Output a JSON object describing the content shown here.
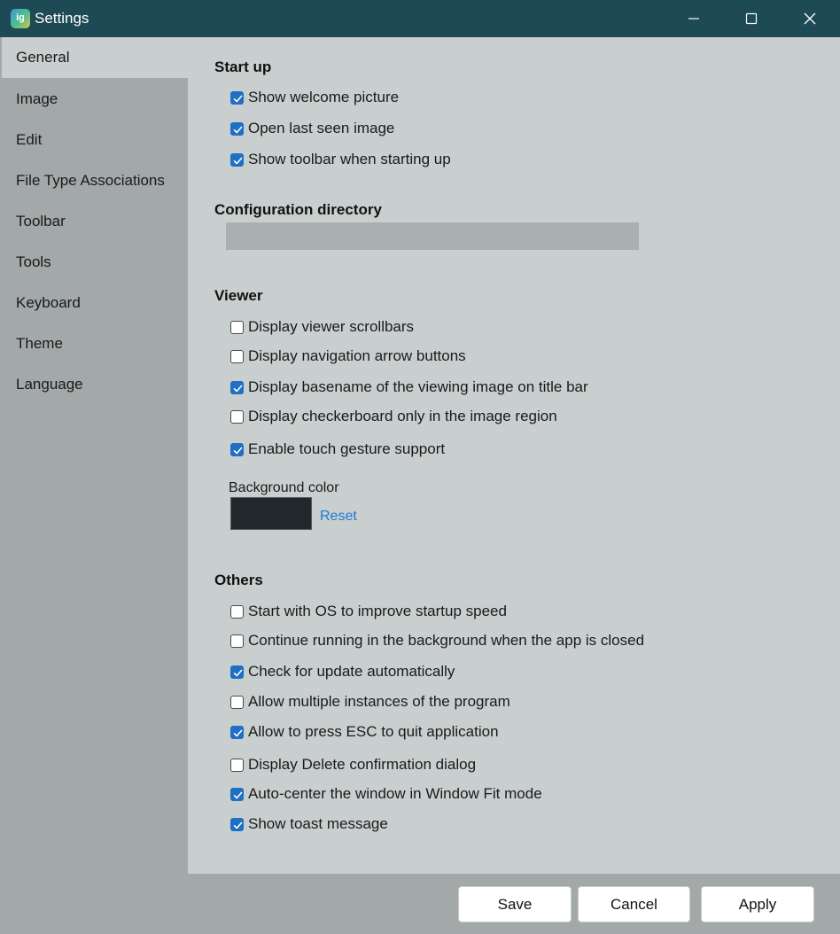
{
  "window": {
    "title": "Settings",
    "app_icon_text": "ig",
    "controls": [
      "minimize-icon",
      "maximize-icon",
      "close-icon"
    ]
  },
  "sidebar": {
    "items": [
      {
        "label": "General",
        "active": true
      },
      {
        "label": "Image",
        "active": false
      },
      {
        "label": "Edit",
        "active": false
      },
      {
        "label": "File Type Associations",
        "active": false
      },
      {
        "label": "Toolbar",
        "active": false
      },
      {
        "label": "Tools",
        "active": false
      },
      {
        "label": "Keyboard",
        "active": false
      },
      {
        "label": "Theme",
        "active": false
      },
      {
        "label": "Language",
        "active": false
      }
    ]
  },
  "startup": {
    "title": "Start up",
    "options": [
      {
        "label": "Show welcome picture",
        "checked": true
      },
      {
        "label": "Open last seen image",
        "checked": true
      },
      {
        "label": "Show toolbar when starting up",
        "checked": true
      }
    ]
  },
  "config": {
    "title": "Configuration directory",
    "value": ""
  },
  "viewer": {
    "title": "Viewer",
    "options": [
      {
        "label": "Display viewer scrollbars",
        "checked": false
      },
      {
        "label": "Display navigation arrow buttons",
        "checked": false
      },
      {
        "label": "Display basename of the viewing image on title bar",
        "checked": true
      },
      {
        "label": "Display checkerboard only in the image region",
        "checked": false
      },
      {
        "label": "Enable touch gesture support",
        "checked": true
      }
    ],
    "background_label": "Background color",
    "background_color": "#22272b",
    "reset_label": "Reset"
  },
  "others": {
    "title": "Others",
    "options": [
      {
        "label": "Start with OS to improve startup speed",
        "checked": false
      },
      {
        "label": "Continue running in the background when the app is closed",
        "checked": false
      },
      {
        "label": "Check for update automatically",
        "checked": true
      },
      {
        "label": "Allow multiple instances of the program",
        "checked": false
      },
      {
        "label": "Allow to press ESC to quit application",
        "checked": true
      },
      {
        "label": "Display Delete confirmation dialog",
        "checked": false
      },
      {
        "label": "Auto-center the window in Window Fit mode",
        "checked": true
      },
      {
        "label": "Show toast message",
        "checked": true
      }
    ]
  },
  "footer": {
    "save_label": "Save",
    "cancel_label": "Cancel",
    "apply_label": "Apply"
  },
  "colors": {
    "titlebar": "#1e4a55",
    "sidebar": "#a3a8a9",
    "content": "#c9cfcf",
    "checkbox_accent": "#1f6fc5",
    "link": "#1f78d1"
  }
}
